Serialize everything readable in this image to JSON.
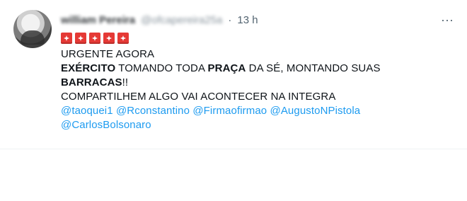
{
  "tweet": {
    "author_name": "william Pereira",
    "author_handle": "@ofcapereira25a",
    "separator": "·",
    "time": "13 h",
    "more_label": "···",
    "text": {
      "line1": "URGENTE AGORA",
      "line2": {
        "b1": "EXÉRCITO",
        "t1": " TOMANDO TODA ",
        "b2": "PRAÇA",
        "t2": " DA SÉ, MONTANDO SUAS"
      },
      "line3": {
        "b1": "BARRACAS",
        "t1": "!!"
      },
      "line4": "COMPARTILHEM ALGO VAI ACONTECER NA INTEGRA",
      "mentions_row1": [
        "@taoquei1",
        "@Rconstantino",
        "@Firmaofirmao",
        "@AugustoNPistola"
      ],
      "mentions_row2": [
        "@CarlosBolsonaro"
      ]
    },
    "siren_count": 5,
    "colors": {
      "link": "#1d9bf0",
      "text": "#0f1419",
      "muted": "#536471",
      "siren": "#e53935"
    }
  }
}
